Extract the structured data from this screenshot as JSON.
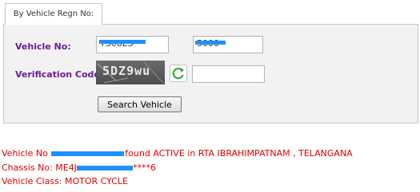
{
  "tab": {
    "label": "By Vehicle Regn No:"
  },
  "form": {
    "vehicle_no_label": "Vehicle No:",
    "vehicle_no_part1": "TS08ES",
    "vehicle_no_part2": "5000",
    "verification_label": "Verification Code:",
    "captcha_text": "5DZ9wu",
    "verification_value": "",
    "search_button": "Search Vehicle"
  },
  "result": {
    "line1_prefix": "Vehicle No",
    "line1_suffix": "found ACTIVE in RTA IBRAHIMPATNAM , TELANGANA",
    "line2_prefix": "Chassis No: ME4J",
    "line2_suffix": "****6",
    "line3": "Vehicle Class: MOTOR CYCLE"
  },
  "colors": {
    "label_purple": "#6a1b9a",
    "result_red": "#e00000",
    "redaction_blue": "#1e90ff",
    "refresh_green": "#3aa63a"
  },
  "icons": {
    "refresh": "refresh-icon"
  }
}
